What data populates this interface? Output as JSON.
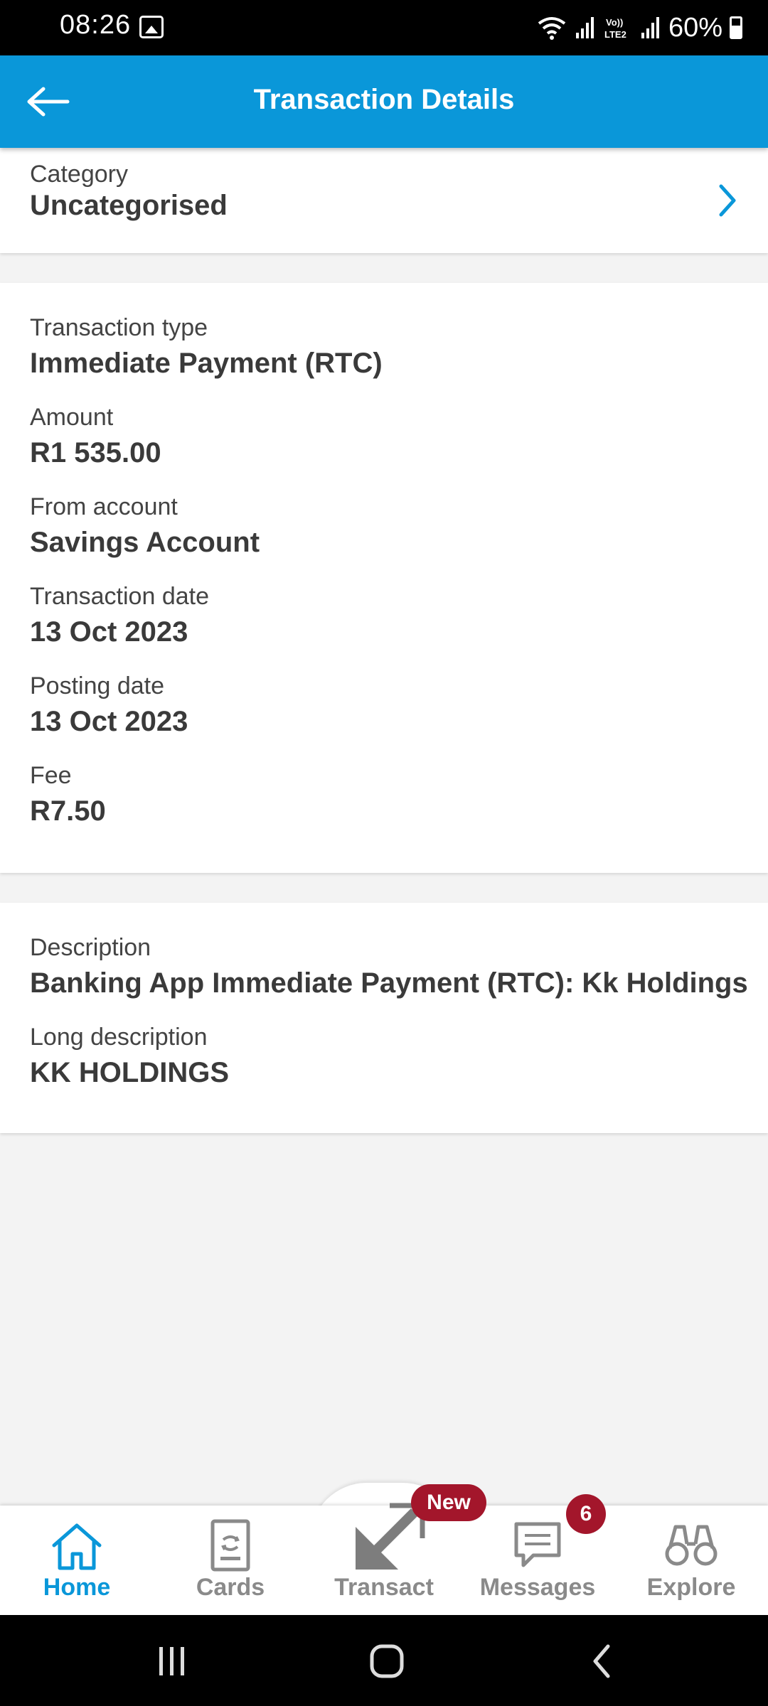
{
  "status_bar": {
    "time": "08:26",
    "battery": "60%",
    "icons": [
      "gallery-icon",
      "wifi-icon",
      "signal-icon",
      "volte-icon",
      "signal-icon",
      "battery-icon"
    ]
  },
  "app_bar": {
    "title": "Transaction Details",
    "back_icon": "arrow-left-icon"
  },
  "category": {
    "label": "Category",
    "value": "Uncategorised"
  },
  "details": [
    {
      "label": "Transaction type",
      "value": "Immediate Payment (RTC)"
    },
    {
      "label": "Amount",
      "value": "R1 535.00"
    },
    {
      "label": "From account",
      "value": "Savings Account"
    },
    {
      "label": "Transaction date",
      "value": "13 Oct 2023"
    },
    {
      "label": "Posting date",
      "value": "13 Oct 2023"
    },
    {
      "label": "Fee",
      "value": "R7.50"
    }
  ],
  "description": [
    {
      "label": "Description",
      "value": "Banking App Immediate Payment (RTC): Kk Holdings"
    },
    {
      "label": "Long description",
      "value": "KK HOLDINGS"
    }
  ],
  "bottom_nav": {
    "items": [
      {
        "label": "Home",
        "icon": "home-icon",
        "active": true
      },
      {
        "label": "Cards",
        "icon": "card-icon",
        "active": false
      },
      {
        "label": "Transact",
        "icon": "transact-arrows-icon",
        "active": false
      },
      {
        "label": "Messages",
        "icon": "message-icon",
        "active": false
      },
      {
        "label": "Explore",
        "icon": "binoculars-icon",
        "active": false
      }
    ],
    "transact_badge": "New",
    "messages_badge": "6"
  },
  "colors": {
    "primary": "#0a97d9",
    "badge": "#a3162b",
    "background": "#f3f3f3",
    "inactive": "#8a8a8a"
  }
}
